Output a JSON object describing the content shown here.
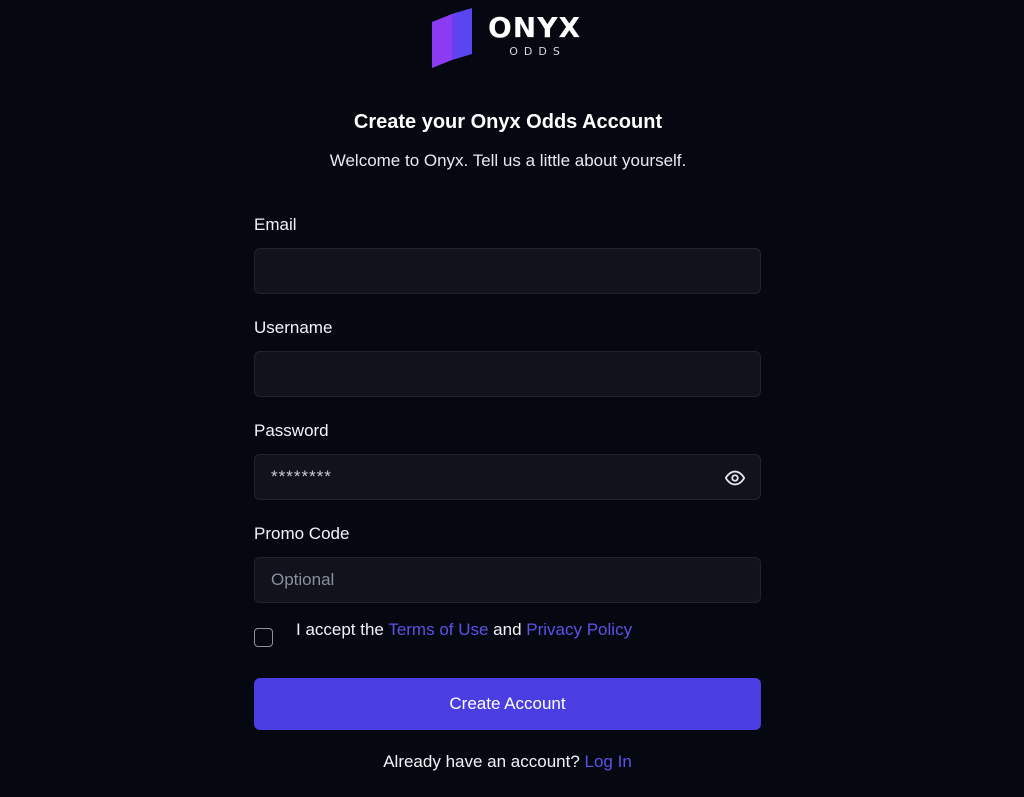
{
  "brand": {
    "name": "ONYX",
    "subname": "ODDS",
    "colors": {
      "mark_left": "#8b3cf2",
      "mark_right": "#5a46f0",
      "accent": "#4a3ee3",
      "link": "#5b52e8",
      "background": "#050811",
      "input_bg": "#10131c"
    }
  },
  "header": {
    "title": "Create your Onyx Odds Account",
    "subtitle": "Welcome to Onyx. Tell us a little about yourself."
  },
  "form": {
    "email": {
      "label": "Email",
      "value": "",
      "placeholder": ""
    },
    "username": {
      "label": "Username",
      "value": "",
      "placeholder": ""
    },
    "password": {
      "label": "Password",
      "value": "********",
      "placeholder": "",
      "toggle_icon": "eye-icon"
    },
    "promo": {
      "label": "Promo Code",
      "value": "",
      "placeholder": "Optional"
    },
    "terms": {
      "checked": false,
      "prefix": "I accept the ",
      "terms_link": "Terms of Use",
      "middle": " and ",
      "privacy_link": "Privacy Policy"
    },
    "submit_label": "Create Account"
  },
  "footer": {
    "prompt": "Already have an account? ",
    "login_link": "Log In"
  }
}
